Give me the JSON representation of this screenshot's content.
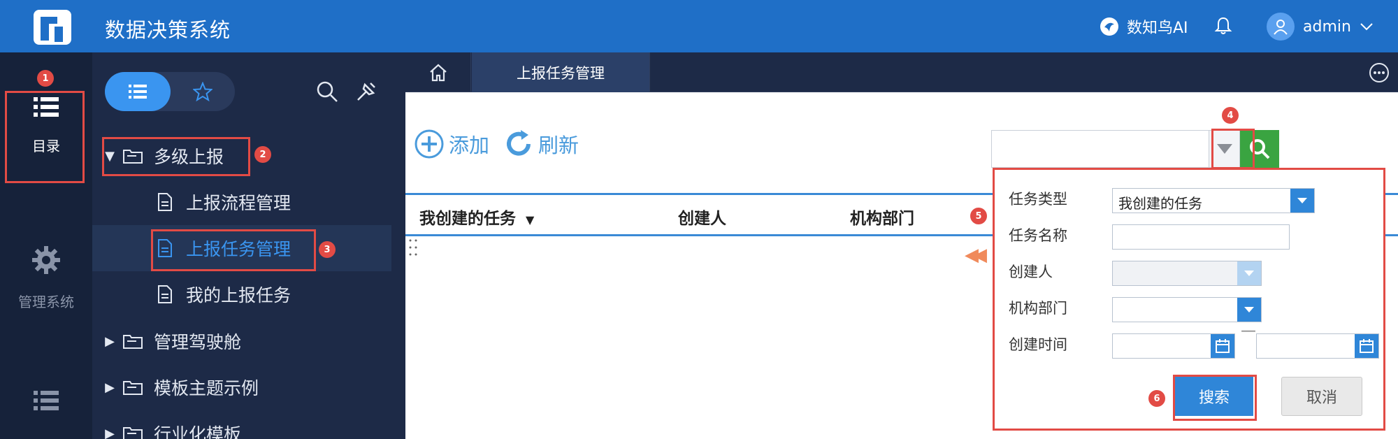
{
  "header": {
    "app_title": "数据决策系统",
    "ai_label": "数知鸟AI",
    "user_name": "admin"
  },
  "rail": {
    "items": [
      {
        "label": "目录",
        "icon": "list-icon"
      },
      {
        "label": "管理系统",
        "icon": "gear-icon"
      },
      {
        "label": "",
        "icon": "list-icon"
      }
    ]
  },
  "tree": {
    "nodes": [
      {
        "label": "多级上报",
        "type": "folder",
        "expanded": true
      },
      {
        "label": "上报流程管理",
        "type": "doc"
      },
      {
        "label": "上报任务管理",
        "type": "doc",
        "selected": true
      },
      {
        "label": "我的上报任务",
        "type": "doc"
      },
      {
        "label": "管理驾驶舱",
        "type": "folder",
        "expanded": false
      },
      {
        "label": "模板主题示例",
        "type": "folder",
        "expanded": false
      },
      {
        "label": "行业化模板",
        "type": "folder",
        "expanded": false
      }
    ]
  },
  "tabs": {
    "active_label": "上报任务管理"
  },
  "toolbar": {
    "add_label": "添加",
    "refresh_label": "刷新"
  },
  "grid": {
    "columns": [
      "我创建的任务",
      "创建人",
      "机构部门"
    ]
  },
  "filter": {
    "labels": {
      "task_type": "任务类型",
      "task_name": "任务名称",
      "creator": "创建人",
      "department": "机构部门",
      "created_time": "创建时间"
    },
    "task_type_value": "我创建的任务",
    "search_label": "搜索",
    "cancel_label": "取消"
  },
  "annotations": [
    "1",
    "2",
    "3",
    "4",
    "5",
    "6"
  ],
  "colors": {
    "topbar": "#1f6fc7",
    "sidebar": "#1d2a47",
    "accent": "#3a95f0",
    "highlight": "#e24b45",
    "go_button": "#3aa441"
  }
}
